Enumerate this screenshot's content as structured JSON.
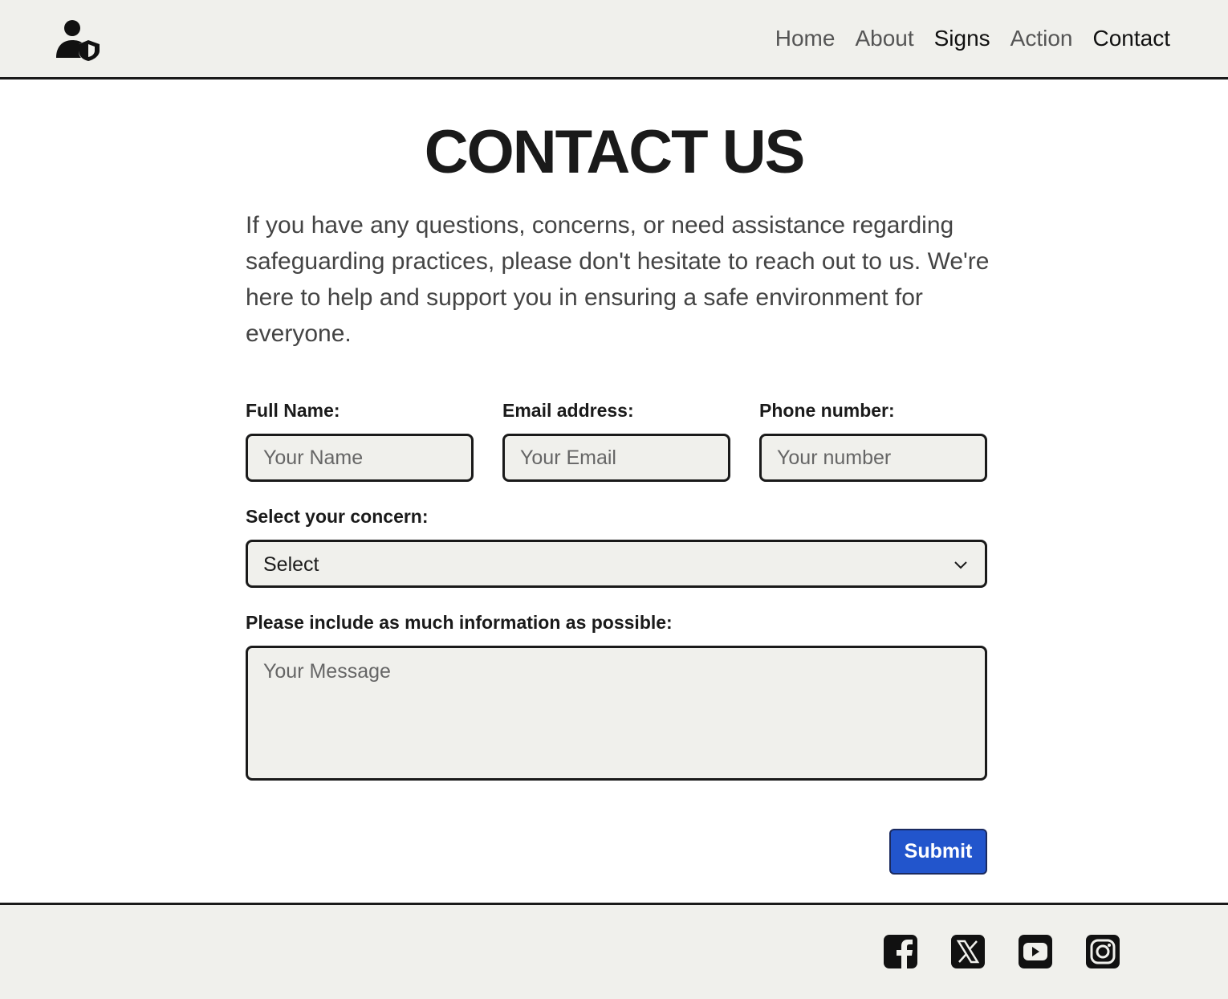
{
  "header": {
    "logo_icon": "user-shield-icon",
    "nav": [
      {
        "label": "Home"
      },
      {
        "label": "About"
      },
      {
        "label": "Signs"
      },
      {
        "label": "Action"
      },
      {
        "label": "Contact"
      }
    ]
  },
  "main": {
    "title": "CONTACT US",
    "intro": "If you have any questions, concerns, or need assistance regarding safeguarding practices, please don't hesitate to reach out to us. We're here to help and support you in ensuring a safe environment for everyone.",
    "form": {
      "name_label": "Full Name:",
      "name_placeholder": "Your Name",
      "email_label": "Email address:",
      "email_placeholder": "Your Email",
      "phone_label": "Phone number:",
      "phone_placeholder": "Your number",
      "concern_label": "Select your concern:",
      "concern_selected": "Select",
      "message_label": "Please include as much information as possible:",
      "message_placeholder": "Your Message",
      "submit_label": "Submit"
    }
  },
  "footer": {
    "social_icons": [
      "facebook-icon",
      "x-twitter-icon",
      "youtube-icon",
      "instagram-icon"
    ]
  },
  "colors": {
    "accent": "#2255cc",
    "panel_bg": "#f0f0ec",
    "text": "#1a1a1a"
  }
}
